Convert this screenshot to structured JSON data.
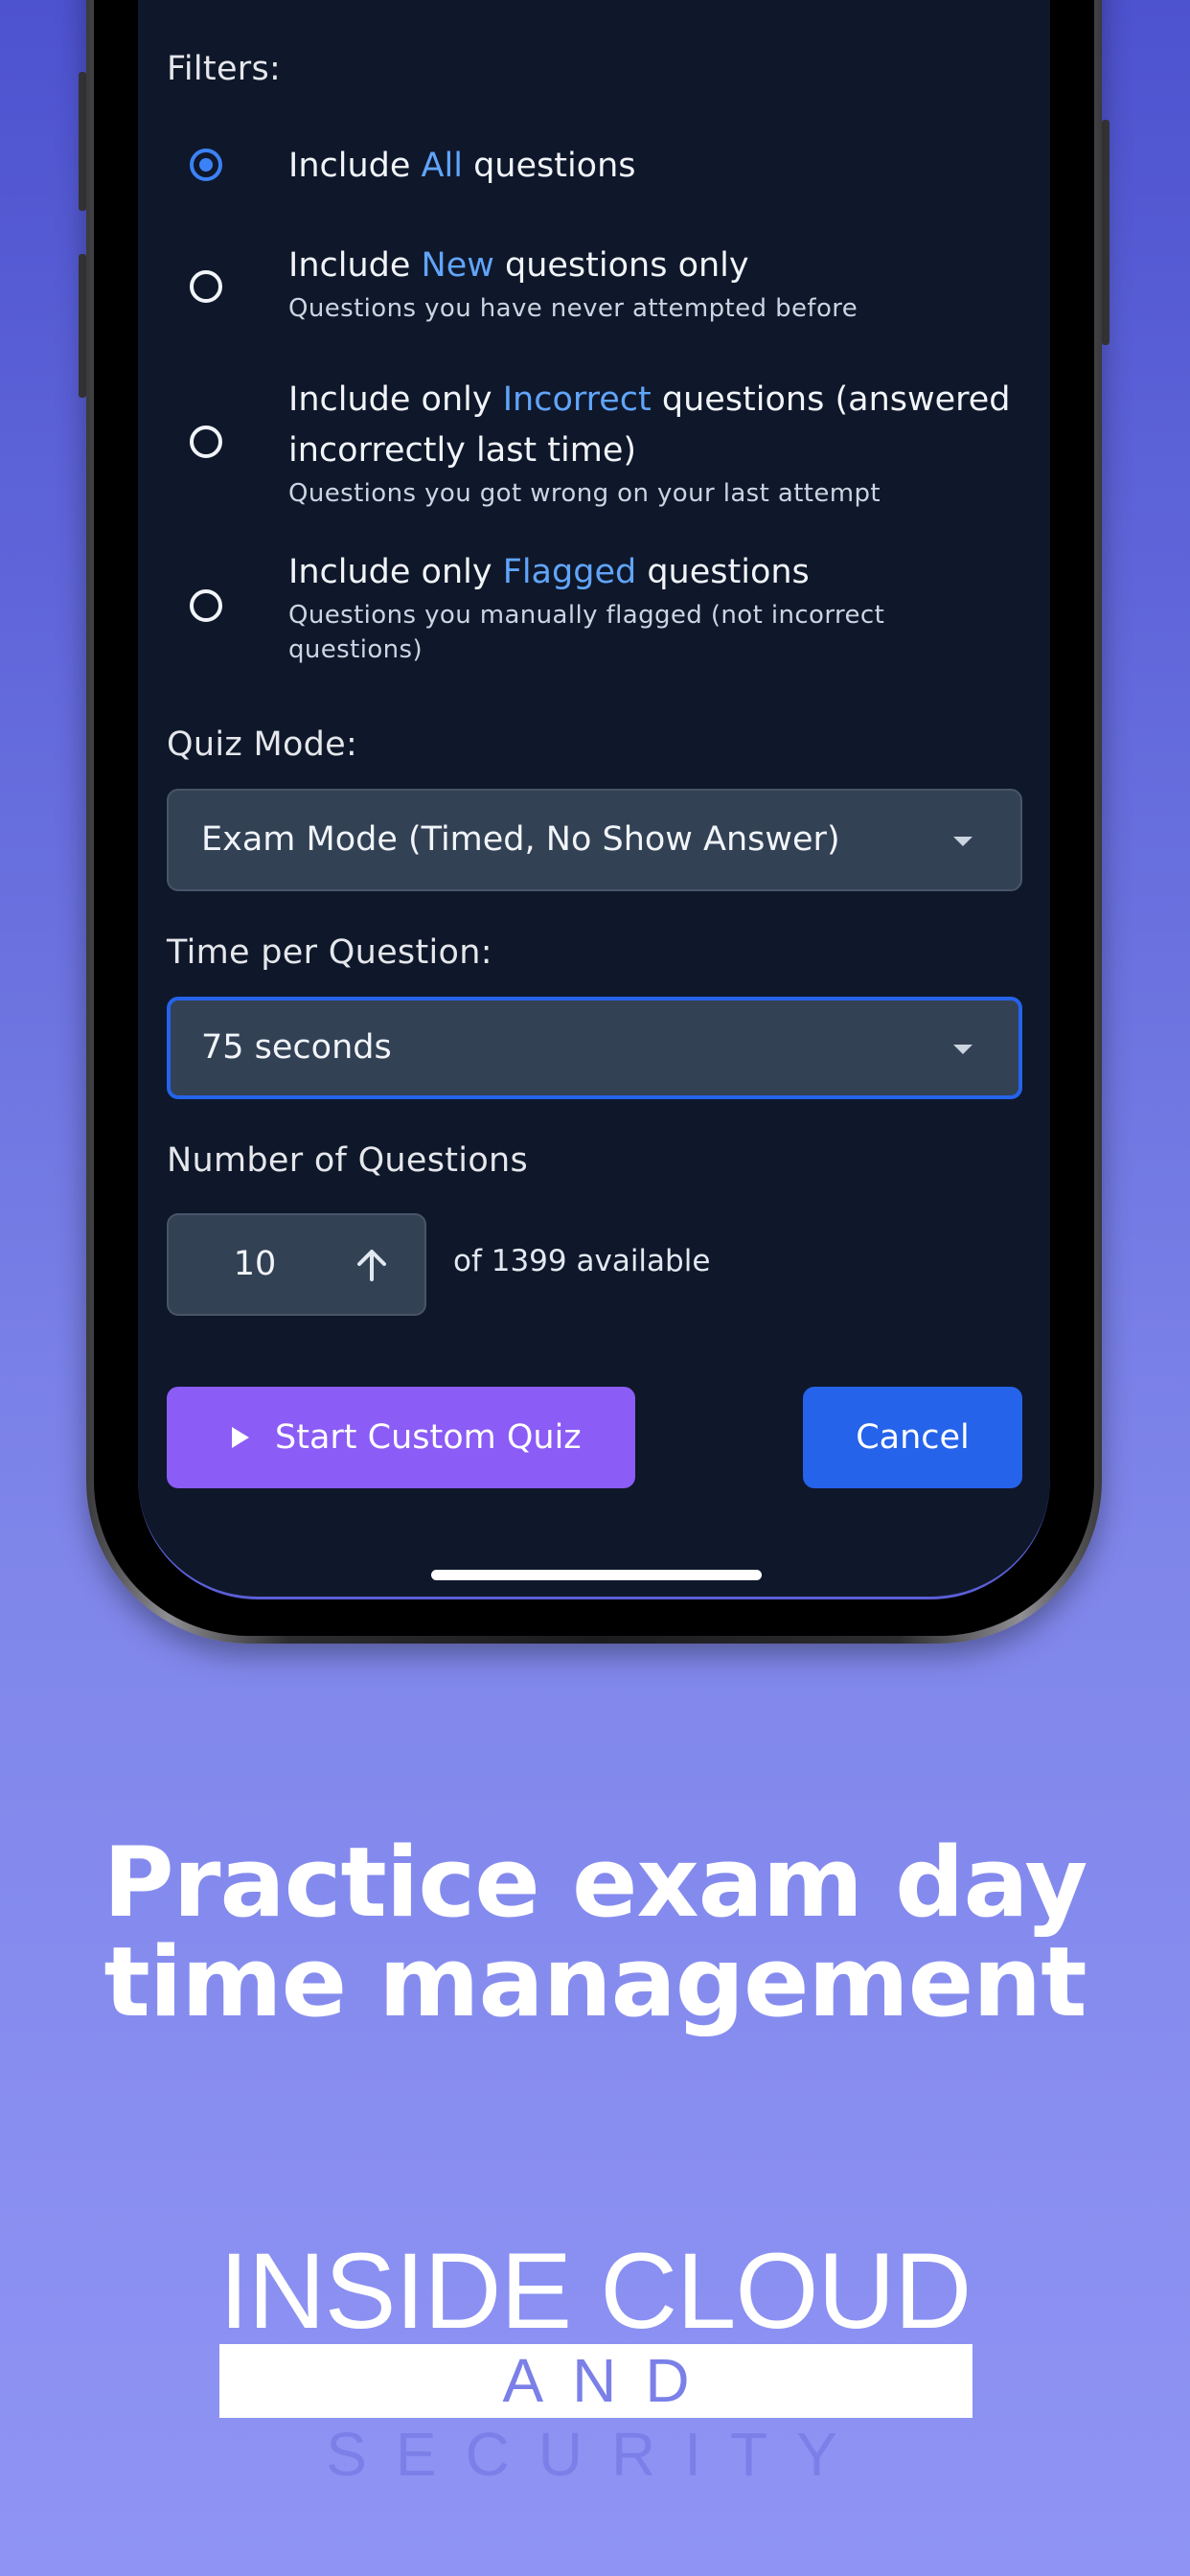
{
  "filters": {
    "heading": "Filters:",
    "options": [
      {
        "pre": "Include ",
        "highlight": "All",
        "post": " questions",
        "line2": "",
        "subtitle": "",
        "selected": true
      },
      {
        "pre": "Include ",
        "highlight": "New",
        "post": " questions only",
        "line2": "",
        "subtitle": "Questions you have never attempted before",
        "selected": false
      },
      {
        "pre": "Include only ",
        "highlight": "Incorrect",
        "post": " questions (answered",
        "line2": "incorrectly last time)",
        "subtitle": "Questions you got wrong on your last attempt",
        "selected": false
      },
      {
        "pre": "Include only ",
        "highlight": "Flagged",
        "post": " questions",
        "line2": "",
        "subtitle_line1": "Questions you manually flagged (not incorrect",
        "subtitle_line2": "questions)",
        "selected": false
      }
    ]
  },
  "quiz_mode": {
    "label": "Quiz Mode:",
    "selected": "Exam Mode (Timed, No Show Answer)"
  },
  "time_per_question": {
    "label": "Time per Question:",
    "selected": "75 seconds"
  },
  "number_of_questions": {
    "label": "Number of Questions",
    "value": "10",
    "available_text": "of 1399 available"
  },
  "buttons": {
    "start": "Start Custom Quiz",
    "cancel": "Cancel"
  },
  "marketing": {
    "headline_line1": "Practice exam day",
    "headline_line2": "time management",
    "logo_top": "INSIDE CLOUD",
    "logo_bottom": "AND SECURITY"
  },
  "colors": {
    "screen_bg": "#0f172a",
    "accent_blue": "#3b82f6",
    "highlight_text": "#60a5fa",
    "start_button": "#8b5cf6",
    "cancel_button": "#2563eb"
  },
  "icons": {
    "start_button": "play-icon",
    "stepper": "arrow-up-icon",
    "select": "caret-down-icon"
  }
}
